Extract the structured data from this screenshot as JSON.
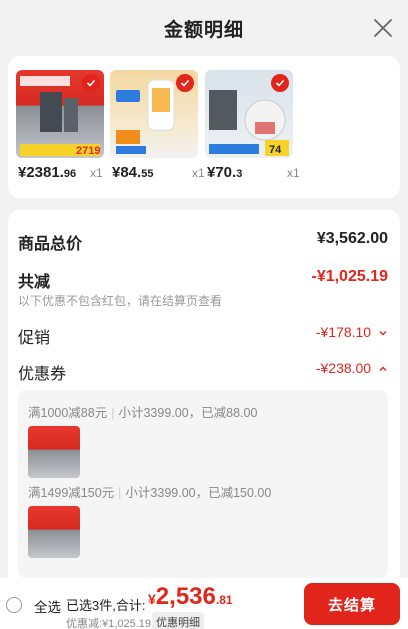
{
  "header": {
    "title": "金额明细"
  },
  "products": [
    {
      "price_int": "¥2381.",
      "price_dec": "96",
      "qty": "x1",
      "thumb_text": "2719"
    },
    {
      "price_int": "¥84.",
      "price_dec": "55",
      "qty": "x1",
      "thumb_text": ""
    },
    {
      "price_int": "¥70.",
      "price_dec": "3",
      "qty": "x1",
      "thumb_text": "74"
    }
  ],
  "summary": {
    "total_label": "商品总价",
    "total_value": "¥3,562.00",
    "reduce_label": "共减",
    "reduce_value": "-¥1,025.19",
    "reduce_note": "以下优惠不包含红包，请在结算页查看",
    "promo_label": "促销",
    "promo_value": "-¥178.10",
    "coupon_label": "优惠券",
    "coupon_value": "-¥238.00"
  },
  "coupons": [
    {
      "rule": "满1000减88元",
      "subtotal": "小计3399.00，已减88.00"
    },
    {
      "rule": "满1499减150元",
      "subtotal": "小计3399.00，已减150.00"
    }
  ],
  "bottom": {
    "select_all": "全选",
    "selected": "已选3件,合计:",
    "total_cur": "¥",
    "total_int": "2,536",
    "total_dec": ".81",
    "discount_note": "优惠减:¥1,025.19",
    "detail_label": "优惠明细",
    "checkout_label": "去结算"
  },
  "colors": {
    "accent": "#e1251b",
    "background": "#f2f2f2"
  }
}
